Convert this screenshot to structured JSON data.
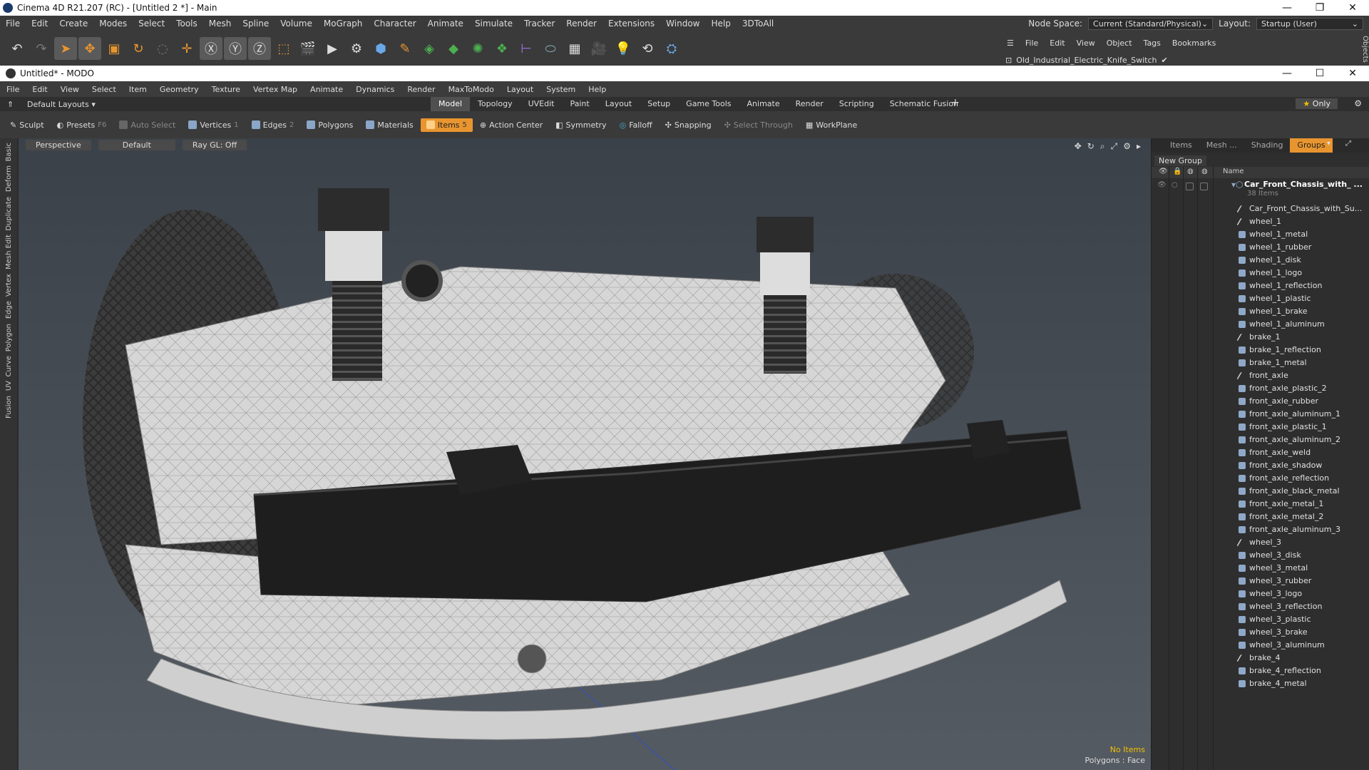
{
  "c4d": {
    "title": "Cinema 4D R21.207 (RC) - [Untitled 2 *] - Main",
    "menu": [
      "File",
      "Edit",
      "Create",
      "Modes",
      "Select",
      "Tools",
      "Mesh",
      "Spline",
      "Volume",
      "MoGraph",
      "Character",
      "Animate",
      "Simulate",
      "Tracker",
      "Render",
      "Extensions",
      "Window",
      "Help",
      "3DToAll"
    ],
    "node_space_label": "Node Space:",
    "node_space_value": "Current (Standard/Physical)",
    "layout_label": "Layout:",
    "layout_value": "Startup (User)",
    "object_menu": [
      "File",
      "Edit",
      "View",
      "Object",
      "Tags",
      "Bookmarks"
    ],
    "object_name": "Old_Industrial_Electric_Knife_Switch",
    "side_label": "Objects"
  },
  "modo": {
    "title": "Untitled* - MODO",
    "menu": [
      "File",
      "Edit",
      "View",
      "Select",
      "Item",
      "Geometry",
      "Texture",
      "Vertex Map",
      "Animate",
      "Dynamics",
      "Render",
      "MaxToModo",
      "Layout",
      "System",
      "Help"
    ],
    "layouts_dropdown": "Default Layouts",
    "tabs": [
      "Model",
      "Topology",
      "UVEdit",
      "Paint",
      "Layout",
      "Setup",
      "Game Tools",
      "Animate",
      "Render",
      "Scripting",
      "Schematic Fusion"
    ],
    "active_tab": "Model",
    "only_label": "Only",
    "toolbar": {
      "sculpt": "Sculpt",
      "presets": "Presets",
      "presets_key": "F6",
      "auto_select": "Auto Select",
      "vertices": "Vertices",
      "vertices_key": "1",
      "edges": "Edges",
      "edges_key": "2",
      "polygons": "Polygons",
      "materials": "Materials",
      "items": "Items",
      "items_key": "5",
      "action_center": "Action Center",
      "symmetry": "Symmetry",
      "falloff": "Falloff",
      "snapping": "Snapping",
      "select_through": "Select Through",
      "workplane": "WorkPlane"
    },
    "left_tabs": [
      "Basic",
      "Deform",
      "Duplicate",
      "Mesh Edit",
      "Vertex",
      "Edge",
      "Polygon",
      "Curve",
      "UV",
      "Fusion"
    ],
    "viewport": {
      "view": "Perspective",
      "shading": "Default",
      "raygl": "Ray GL: Off",
      "status_items": "No Items",
      "status_mode": "Polygons : Face"
    },
    "panel": {
      "tabs": [
        "Items",
        "Mesh ...",
        "Shading",
        "Groups"
      ],
      "active_tab": "Groups",
      "new_group": "New Group",
      "col_name": "Name",
      "group_name": "Car_Front_Chassis_with_ ...",
      "group_count": "38 Items",
      "items": [
        {
          "name": "Car_Front_Chassis_with_Su...",
          "type": "locator"
        },
        {
          "name": "wheel_1",
          "type": "locator"
        },
        {
          "name": "wheel_1_metal",
          "type": "mesh"
        },
        {
          "name": "wheel_1_rubber",
          "type": "mesh"
        },
        {
          "name": "wheel_1_disk",
          "type": "mesh"
        },
        {
          "name": "wheel_1_logo",
          "type": "mesh"
        },
        {
          "name": "wheel_1_reflection",
          "type": "mesh"
        },
        {
          "name": "wheel_1_plastic",
          "type": "mesh"
        },
        {
          "name": "wheel_1_brake",
          "type": "mesh"
        },
        {
          "name": "wheel_1_aluminum",
          "type": "mesh"
        },
        {
          "name": "brake_1",
          "type": "locator"
        },
        {
          "name": "brake_1_reflection",
          "type": "mesh"
        },
        {
          "name": "brake_1_metal",
          "type": "mesh"
        },
        {
          "name": "front_axle",
          "type": "locator"
        },
        {
          "name": "front_axle_plastic_2",
          "type": "mesh"
        },
        {
          "name": "front_axle_rubber",
          "type": "mesh"
        },
        {
          "name": "front_axle_aluminum_1",
          "type": "mesh"
        },
        {
          "name": "front_axle_plastic_1",
          "type": "mesh"
        },
        {
          "name": "front_axle_aluminum_2",
          "type": "mesh"
        },
        {
          "name": "front_axle_weld",
          "type": "mesh"
        },
        {
          "name": "front_axle_shadow",
          "type": "mesh"
        },
        {
          "name": "front_axle_reflection",
          "type": "mesh"
        },
        {
          "name": "front_axle_black_metal",
          "type": "mesh"
        },
        {
          "name": "front_axle_metal_1",
          "type": "mesh"
        },
        {
          "name": "front_axle_metal_2",
          "type": "mesh"
        },
        {
          "name": "front_axle_aluminum_3",
          "type": "mesh"
        },
        {
          "name": "wheel_3",
          "type": "locator"
        },
        {
          "name": "wheel_3_disk",
          "type": "mesh"
        },
        {
          "name": "wheel_3_metal",
          "type": "mesh"
        },
        {
          "name": "wheel_3_rubber",
          "type": "mesh"
        },
        {
          "name": "wheel_3_logo",
          "type": "mesh"
        },
        {
          "name": "wheel_3_reflection",
          "type": "mesh"
        },
        {
          "name": "wheel_3_plastic",
          "type": "mesh"
        },
        {
          "name": "wheel_3_brake",
          "type": "mesh"
        },
        {
          "name": "wheel_3_aluminum",
          "type": "mesh"
        },
        {
          "name": "brake_4",
          "type": "locator"
        },
        {
          "name": "brake_4_reflection",
          "type": "mesh"
        },
        {
          "name": "brake_4_metal",
          "type": "mesh"
        }
      ]
    }
  },
  "colors": {
    "accent": "#e8952f",
    "status_yellow": "#f0c000"
  }
}
